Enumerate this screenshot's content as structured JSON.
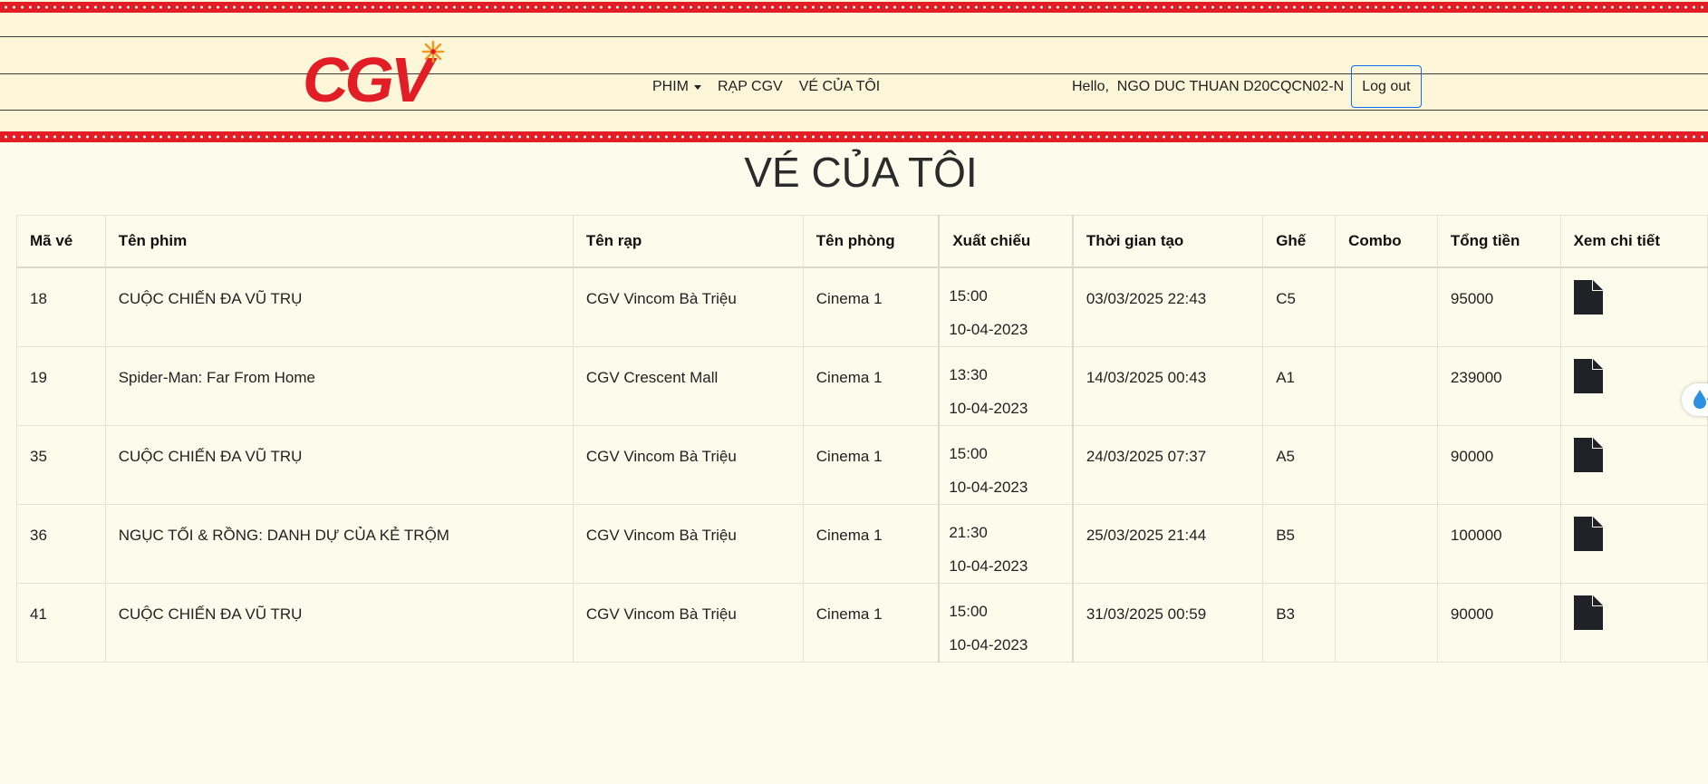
{
  "brand": {
    "logo_text": "CGV",
    "color": "#e31d25"
  },
  "nav": {
    "items": [
      {
        "label": "PHIM",
        "has_dropdown": true
      },
      {
        "label": "RẠP CGV"
      },
      {
        "label": "VÉ CỦA TÔI"
      }
    ]
  },
  "user": {
    "greeting": "Hello,  NGO DUC THUAN D20CQCN02-N",
    "logout_label": "Log out"
  },
  "page": {
    "title": "VÉ CỦA TÔI"
  },
  "table": {
    "headers": [
      "Mã vé",
      "Tên phim",
      "Tên rạp",
      "Tên phòng",
      "Xuất chiếu",
      "Thời gian tạo",
      "Ghế",
      "Combo",
      "Tổng tiền",
      "Xem chi tiết"
    ],
    "rows": [
      {
        "id": "18",
        "movie": "CUỘC CHIẾN ĐA VŨ TRỤ",
        "cinema": "CGV Vincom Bà Triệu",
        "room": "Cinema 1",
        "show_time": "15:00",
        "show_date": "10-04-2023",
        "created": "03/03/2025 22:43",
        "seat": "C5",
        "combo": "",
        "total": "95000",
        "detail_icon": "file-icon"
      },
      {
        "id": "19",
        "movie": "Spider-Man: Far From Home",
        "cinema": "CGV Crescent Mall",
        "room": "Cinema 1",
        "show_time": "13:30",
        "show_date": "10-04-2023",
        "created": "14/03/2025 00:43",
        "seat": "A1",
        "combo": "",
        "total": "239000",
        "detail_icon": "file-icon"
      },
      {
        "id": "35",
        "movie": "CUỘC CHIẾN ĐA VŨ TRỤ",
        "cinema": "CGV Vincom Bà Triệu",
        "room": "Cinema 1",
        "show_time": "15:00",
        "show_date": "10-04-2023",
        "created": "24/03/2025 07:37",
        "seat": "A5",
        "combo": "",
        "total": "90000",
        "detail_icon": "file-icon"
      },
      {
        "id": "36",
        "movie": "NGỤC TỐI & RỒNG: DANH DỰ CỦA KẺ TRỘM",
        "cinema": "CGV Vincom Bà Triệu",
        "room": "Cinema 1",
        "show_time": "21:30",
        "show_date": "10-04-2023",
        "created": "25/03/2025 21:44",
        "seat": "B5",
        "combo": "",
        "total": "100000",
        "detail_icon": "file-icon"
      },
      {
        "id": "41",
        "movie": "CUỘC CHIẾN ĐA VŨ TRỤ",
        "cinema": "CGV Vincom Bà Triệu",
        "room": "Cinema 1",
        "show_time": "15:00",
        "show_date": "10-04-2023",
        "created": "31/03/2025 00:59",
        "seat": "B3",
        "combo": "",
        "total": "90000",
        "detail_icon": "file-icon"
      }
    ]
  },
  "colors": {
    "background": "#fdfbeb",
    "header_bg": "#fef6d8",
    "accent_red": "#e31d25",
    "button_border": "#0d6efd"
  }
}
